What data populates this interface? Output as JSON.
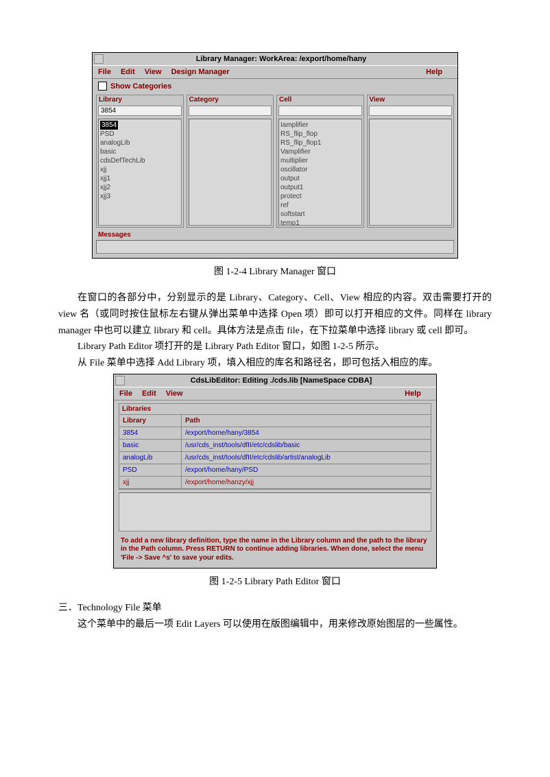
{
  "fig1": {
    "title": "Library Manager: WorkArea: /export/home/hany",
    "menu": {
      "file": "File",
      "edit": "Edit",
      "view": "View",
      "dm": "Design Manager",
      "help": "Help"
    },
    "showCategories": "Show Categories",
    "panes": {
      "library": {
        "label": "Library",
        "filter": "3854",
        "items": [
          "3854",
          "PSD",
          "analogLib",
          "basic",
          "cdsDefTechLib",
          "xjj",
          "xjj1",
          "xjj2",
          "xjj3"
        ]
      },
      "category": {
        "label": "Category"
      },
      "cell": {
        "label": "Cell",
        "items": [
          "Iamplifier",
          "RS_flip_flop",
          "RS_flip_flop1",
          "Vamplifier",
          "multiplier",
          "oscillator",
          "output",
          "output1",
          "protect",
          "ref",
          "softstart",
          "temp1"
        ]
      },
      "view": {
        "label": "View"
      }
    },
    "messagesLabel": "Messages",
    "caption": "图  1-2-4 Library Manager 窗口"
  },
  "text": {
    "p1": "在窗口的各部分中，分别显示的是 Library、Category、Cell、View 相应的内容。双击需要打开的 view 名（或同时按住鼠标左右键从弹出菜单中选择 Open 项）即可以打开相应的文件。同样在 library  manager 中也可以建立 library 和 cell。具体方法是点击 file，在下拉菜单中选择 library 或 cell 即可。",
    "p2": "Library Path Editor 项打开的是 Library Path Editor 窗口，如图 1-2-5  所示。",
    "p3": "从 File 菜单中选择 Add Library 项，填入相应的库名和路径名，即可包括入相应的库。"
  },
  "fig2": {
    "title": "CdsLibEditor: Editing ./cds.lib [NameSpace CDBA]",
    "menu": {
      "file": "File",
      "edit": "Edit",
      "view": "View",
      "help": "Help"
    },
    "librariesLabel": "Libraries",
    "headers": {
      "lib": "Library",
      "path": "Path"
    },
    "rows": [
      {
        "lib": "3854",
        "path": "/export/home/hany/3854"
      },
      {
        "lib": "basic",
        "path": "/usr/cds_inst/tools/dfII/etc/cdslib/basic"
      },
      {
        "lib": "analogLib",
        "path": "/usr/cds_inst/tools/dfII/etc/cdslib/artist/analogLib"
      },
      {
        "lib": "PSD",
        "path": "/export/home/hany/PSD"
      },
      {
        "lib": "xjj",
        "path": "/export/home/hanzy/xjj",
        "red": true
      }
    ],
    "hint": "To add a new library definition, type the name in the Library column and the path to the library in the Path column.  Press RETURN to continue adding libraries. When done, select the menu 'File -> Save  ^s' to save your edits.",
    "caption": "图  1-2-5    Library Path Editor 窗口"
  },
  "section3": {
    "title": "三．Technology File 菜单",
    "body": "这个菜单中的最后一项 Edit Layers  可以使用在版图编辑中，用来修改原始图层的一些属性。"
  }
}
